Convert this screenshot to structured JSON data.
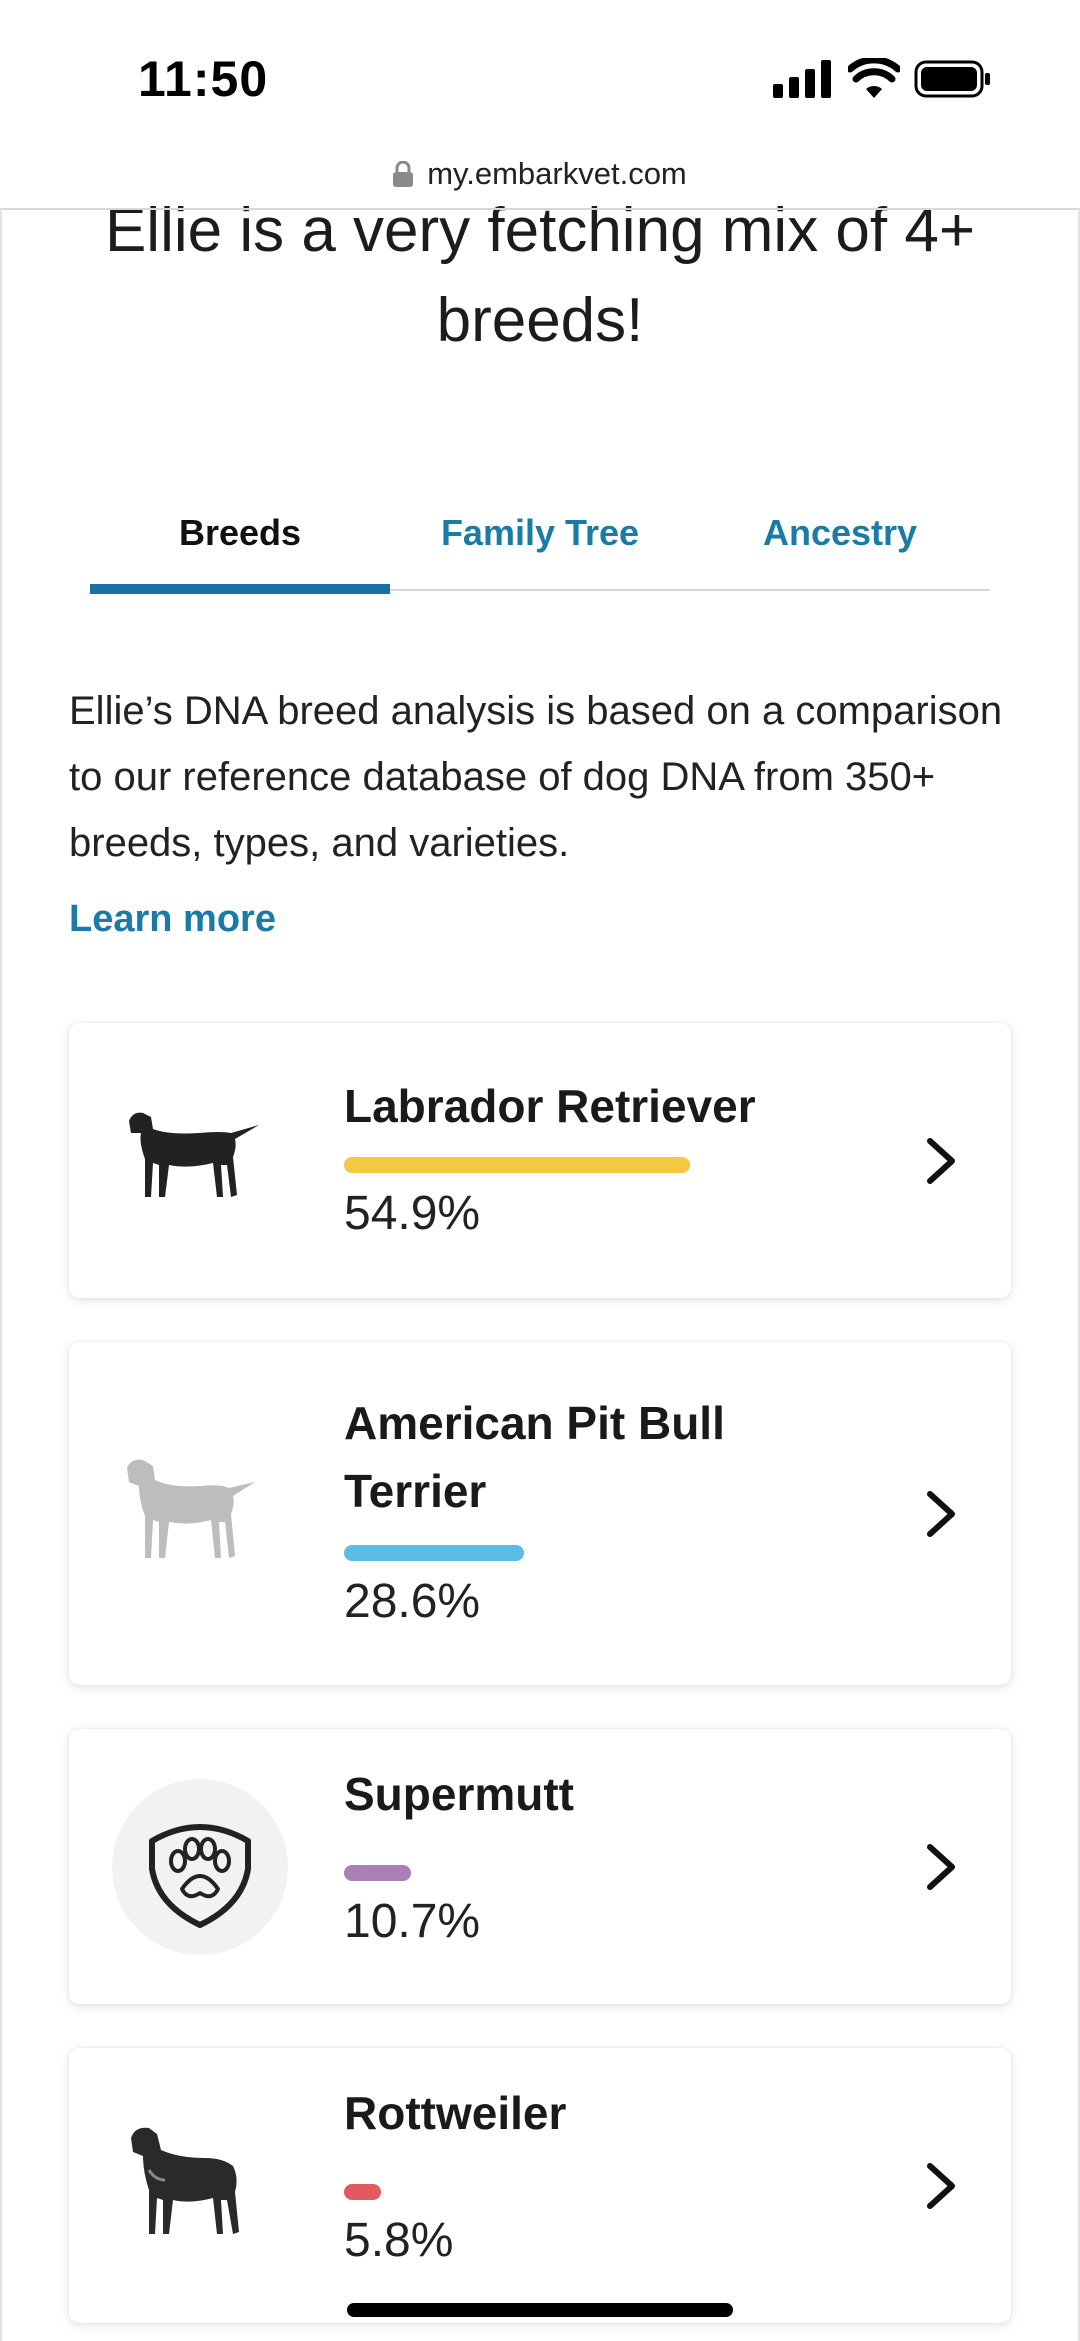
{
  "status_bar": {
    "time": "11:50"
  },
  "url_bar": {
    "domain": "my.embarkvet.com"
  },
  "headline": "Ellie is a very fetching mix of 4+ breeds!",
  "tabs": [
    {
      "label": "Breeds",
      "active": true
    },
    {
      "label": "Family Tree",
      "active": false
    },
    {
      "label": "Ancestry",
      "active": false
    }
  ],
  "description": "Ellie’s DNA breed analysis is based on a comparison to our reference database of dog DNA from 350+ breeds, types, and varieties.",
  "learn_more": "Learn more",
  "breeds": [
    {
      "name": "Labrador Retriever",
      "percent": "54.9%",
      "bar_fraction": 0.549,
      "color": "#f5c842",
      "icon": "labrador-dog-illustration"
    },
    {
      "name": "American Pit Bull Terrier",
      "percent": "28.6%",
      "bar_fraction": 0.286,
      "color": "#5bbde6",
      "icon": "pit-bull-dog-illustration"
    },
    {
      "name": "Supermutt",
      "percent": "10.7%",
      "bar_fraction": 0.107,
      "color": "#a97fb6",
      "icon": "paw-shield-icon"
    },
    {
      "name": "Rottweiler",
      "percent": "5.8%",
      "bar_fraction": 0.058,
      "color": "#e25a5f",
      "icon": "rottweiler-dog-illustration"
    }
  ],
  "colors": {
    "link": "#1a7ba7",
    "tab_active": "#1a6fa3"
  }
}
